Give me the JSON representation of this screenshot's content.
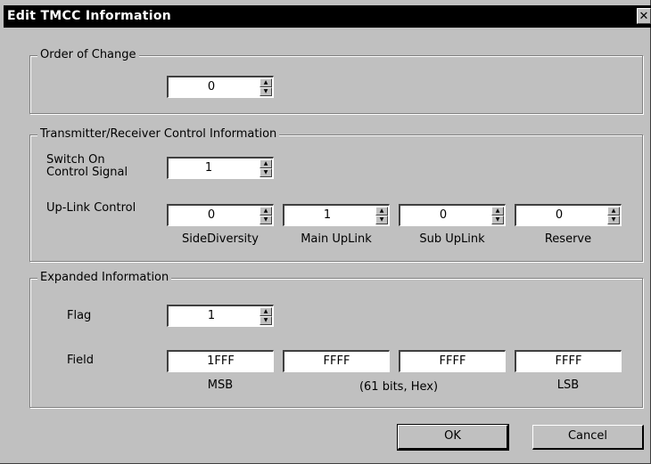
{
  "window": {
    "title": "Edit TMCC Information",
    "close_glyph": "✕"
  },
  "order_group": {
    "legend": "Order of Change",
    "value": "0"
  },
  "trc_group": {
    "legend": "Transmitter/Receiver Control Information",
    "switch_label_line1": "Switch On",
    "switch_label_line2": "Control Signal",
    "switch_value": "1",
    "uplink_label": "Up-Link Control",
    "uplink": [
      {
        "value": "0",
        "caption": "SideDiversity"
      },
      {
        "value": "1",
        "caption": "Main UpLink"
      },
      {
        "value": "0",
        "caption": "Sub UpLink"
      },
      {
        "value": "0",
        "caption": "Reserve"
      }
    ]
  },
  "expanded_group": {
    "legend": "Expanded Information",
    "flag_label": "Flag",
    "flag_value": "1",
    "field_label": "Field",
    "fields": [
      "1FFF",
      "FFFF",
      "FFFF",
      "FFFF"
    ],
    "msb_caption": "MSB",
    "bits_caption": "(61 bits, Hex)",
    "lsb_caption": "LSB"
  },
  "buttons": {
    "ok": "OK",
    "cancel": "Cancel"
  },
  "icons": {
    "spin_up": "up-arrow-icon",
    "spin_down": "down-arrow-icon",
    "close": "close-icon"
  }
}
